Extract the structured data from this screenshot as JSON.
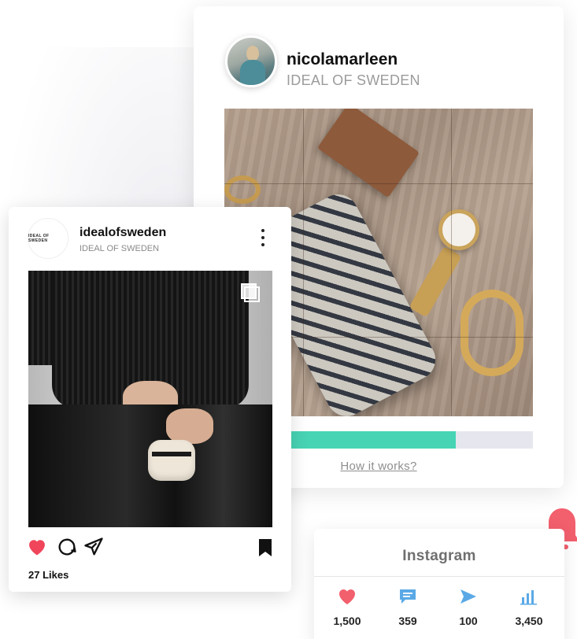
{
  "main_card": {
    "username": "nicolamarleen",
    "subtitle": "IDEAL OF SWEDEN",
    "progress": 0.75,
    "how_link": "How it works?"
  },
  "post_card": {
    "username": "idealofsweden",
    "subtitle": "IDEAL OF SWEDEN",
    "avatar_text": "IDEAL OF SWEDEN",
    "likes": "27 Likes"
  },
  "stats_card": {
    "title": "Instagram",
    "stats": [
      {
        "icon": "heart-icon",
        "value": "1,500",
        "color": "#f25f6d"
      },
      {
        "icon": "comment-icon",
        "value": "359",
        "color": "#5aa9e6"
      },
      {
        "icon": "send-icon",
        "value": "100",
        "color": "#5aa9e6"
      },
      {
        "icon": "bar-chart-icon",
        "value": "3,450",
        "color": "#5aa9e6"
      }
    ]
  },
  "colors": {
    "accent_green": "#47d4b4",
    "like_red": "#f0455a",
    "bell_red": "#f25f6d"
  }
}
